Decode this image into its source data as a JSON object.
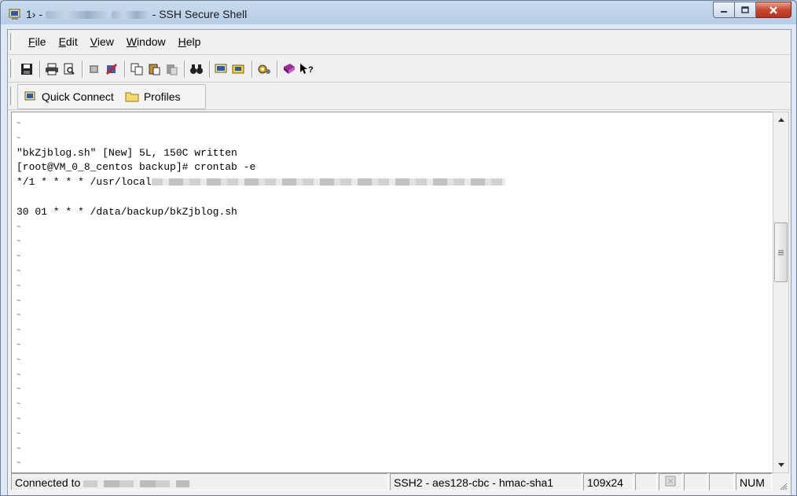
{
  "window": {
    "title_prefix": "1› -",
    "title_suffix": "- SSH Secure Shell",
    "icon": "ssh-terminal-icon"
  },
  "menubar": {
    "items": [
      {
        "label": "File",
        "accel": "F"
      },
      {
        "label": "Edit",
        "accel": "E"
      },
      {
        "label": "View",
        "accel": "V"
      },
      {
        "label": "Window",
        "accel": "W"
      },
      {
        "label": "Help",
        "accel": "H"
      }
    ]
  },
  "toolbar": {
    "icons": [
      "save-icon",
      "print-icon",
      "print-preview-icon",
      "disconnect-icon",
      "disconnect-red-icon",
      "copy-icon",
      "paste-icon",
      "paste-gray-icon",
      "find-icon",
      "new-terminal-icon",
      "new-file-transfer-icon",
      "settings-icon",
      "help-book-icon",
      "whats-this-icon"
    ]
  },
  "quickbar": {
    "quick_connect": "Quick Connect",
    "profiles": "Profiles"
  },
  "terminal": {
    "lines": [
      {
        "text": "~",
        "tilde": true
      },
      {
        "text": "~",
        "tilde": true
      },
      {
        "text": "\"bkZjblog.sh\" [New] 5L, 150C written"
      },
      {
        "text": "[root@VM_0_8_centos backup]# crontab -e"
      },
      {
        "text": "*/1 * * * * /usr/local",
        "redacted": true
      },
      {
        "text": ""
      },
      {
        "text": "30 01 * * * /data/backup/bkZjblog.sh"
      },
      {
        "text": "~",
        "tilde": true
      },
      {
        "text": "~",
        "tilde": true
      },
      {
        "text": "~",
        "tilde": true
      },
      {
        "text": "~",
        "tilde": true
      },
      {
        "text": "~",
        "tilde": true
      },
      {
        "text": "~",
        "tilde": true
      },
      {
        "text": "~",
        "tilde": true
      },
      {
        "text": "~",
        "tilde": true
      },
      {
        "text": "~",
        "tilde": true
      },
      {
        "text": "~",
        "tilde": true
      },
      {
        "text": "~",
        "tilde": true
      },
      {
        "text": "~",
        "tilde": true
      },
      {
        "text": "~",
        "tilde": true
      },
      {
        "text": "~",
        "tilde": true
      },
      {
        "text": "~",
        "tilde": true
      },
      {
        "text": "~",
        "tilde": true
      },
      {
        "text": "~",
        "tilde": true
      },
      {
        "text": "~",
        "tilde": true
      }
    ]
  },
  "statusbar": {
    "connection": "Connected to",
    "cipher": "SSH2 - aes128-cbc - hmac-sha1",
    "size": "109x24",
    "num": "NUM"
  }
}
